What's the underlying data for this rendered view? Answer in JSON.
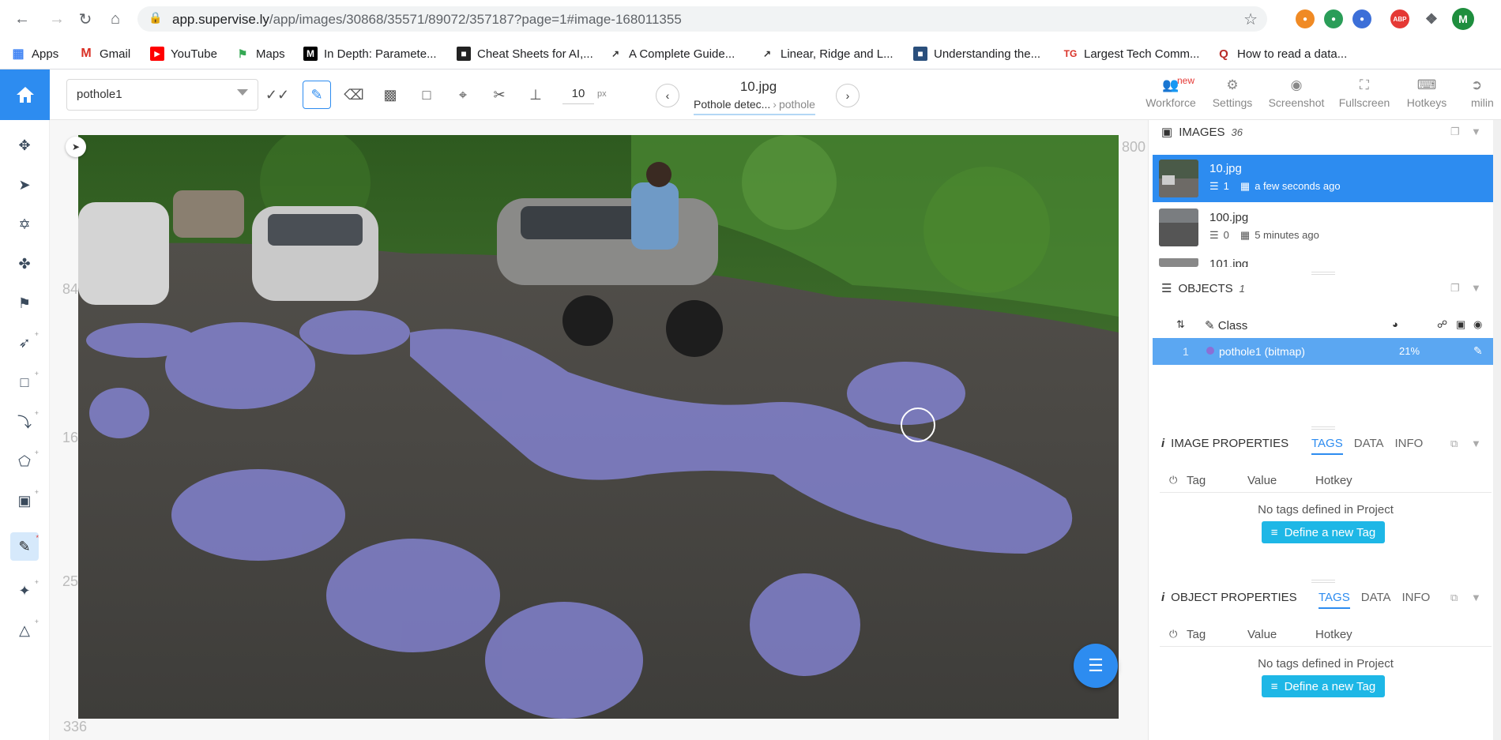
{
  "browser": {
    "url_host": "app.supervise.ly",
    "url_path": "/app/images/30868/35571/89072/357187?page=1#image-168011355",
    "profile_initial": "M",
    "ext_abp": "ABP"
  },
  "bookmarks": [
    {
      "label": "Apps",
      "icon": "apps-grid-icon"
    },
    {
      "label": "Gmail",
      "icon": "gmail-icon"
    },
    {
      "label": "YouTube",
      "icon": "youtube-icon"
    },
    {
      "label": "Maps",
      "icon": "maps-pin-icon"
    },
    {
      "label": "In Depth: Paramete...",
      "icon": "medium-icon"
    },
    {
      "label": "Cheat Sheets for AI,...",
      "icon": "dark-square-icon"
    },
    {
      "label": "A Complete Guide...",
      "icon": "trend-icon"
    },
    {
      "label": "Linear, Ridge and L...",
      "icon": "trend-icon"
    },
    {
      "label": "Understanding the...",
      "icon": "site-icon"
    },
    {
      "label": "Largest Tech Comm...",
      "icon": "tg-icon"
    },
    {
      "label": "How to read a data...",
      "icon": "quora-icon"
    }
  ],
  "toolbar": {
    "class_value": "pothole1",
    "brush_size": "10",
    "brush_unit": "px",
    "file_title": "10.jpg",
    "crumb_project": "Pothole detec...",
    "crumb_dataset": "pothole",
    "right_tools": [
      "Workforce",
      "Settings",
      "Screenshot",
      "Fullscreen",
      "Hotkeys",
      "milin"
    ],
    "new_badge": "new"
  },
  "canvas": {
    "ruler_marks": [
      "84",
      "16",
      "25"
    ],
    "zoom_label": "336",
    "edge_label": "800"
  },
  "images_panel": {
    "title": "IMAGES",
    "count": "36",
    "items": [
      {
        "name": "10.jpg",
        "objects": "1",
        "time": "a few seconds ago",
        "selected": true
      },
      {
        "name": "100.jpg",
        "objects": "0",
        "time": "5 minutes ago",
        "selected": false
      },
      {
        "name": "101.jpg",
        "objects": "",
        "time": "",
        "selected": false
      }
    ]
  },
  "objects_panel": {
    "title": "OBJECTS",
    "count": "1",
    "col_class": "Class",
    "row": {
      "index": "1",
      "label": "pothole1 (bitmap)",
      "percent": "21%",
      "color": "#8b6fd6"
    }
  },
  "image_props": {
    "title": "IMAGE PROPERTIES",
    "tabs": [
      "TAGS",
      "DATA",
      "INFO"
    ],
    "cols": [
      "Tag",
      "Value",
      "Hotkey"
    ],
    "empty": "No tags defined in Project",
    "button": "Define a new Tag"
  },
  "object_props": {
    "title": "OBJECT PROPERTIES",
    "tabs": [
      "TAGS",
      "DATA",
      "INFO"
    ],
    "cols": [
      "Tag",
      "Value",
      "Hotkey"
    ],
    "empty": "No tags defined in Project",
    "button": "Define a new Tag"
  },
  "colors": {
    "accent": "#2d8cf0",
    "mask": "#8c8ce6",
    "tag_button": "#1eb7e6"
  }
}
